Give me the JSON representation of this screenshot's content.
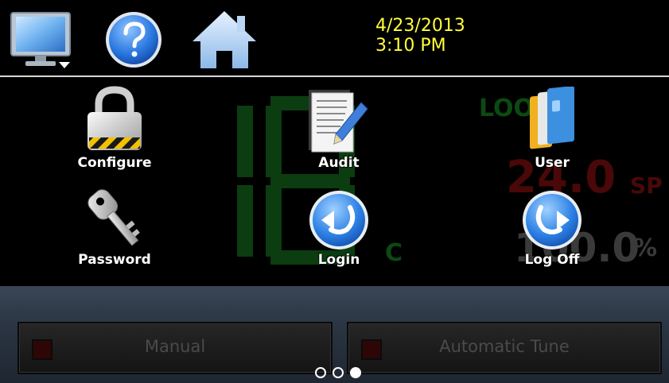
{
  "header": {
    "date": "4/23/2013",
    "time": "3:10 PM",
    "icons": [
      "monitor-icon",
      "help-icon",
      "home-icon"
    ]
  },
  "background_display": {
    "loop_label": "LOO",
    "setpoint_value": "24.0",
    "setpoint_unit": "SP",
    "output_value": "100.0",
    "output_unit": "%",
    "temp_unit": "C",
    "digit_color": "#0b3d10",
    "sp_color": "#4a0808"
  },
  "menu": {
    "configure": "Configure",
    "audit": "Audit",
    "user": "User",
    "password": "Password",
    "login": "Login",
    "logoff": "Log Off"
  },
  "bottom": {
    "manual_label": "Manual",
    "autotune_label": "Automatic Tune",
    "pages": [
      false,
      false,
      true
    ]
  }
}
